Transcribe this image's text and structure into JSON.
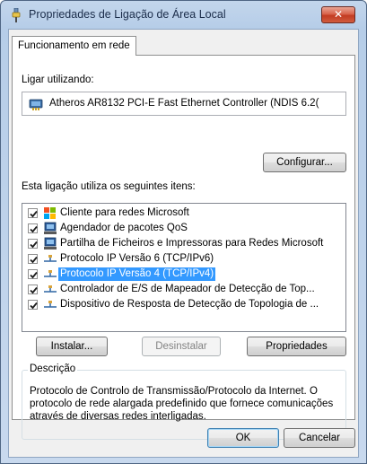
{
  "window": {
    "title": "Propriedades de Ligação de Área Local",
    "close_glyph": "✕"
  },
  "tabs": [
    {
      "label": "Funcionamento em rede",
      "active": true
    }
  ],
  "connect_using": {
    "label": "Ligar utilizando:",
    "adapter_name": "Atheros AR8132 PCI-E Fast Ethernet Controller (NDIS 6.2(",
    "adapter_icon": "network-adapter-icon",
    "configure_button": "Configurar..."
  },
  "items_section": {
    "label": "Esta ligação utiliza os seguintes itens:",
    "items": [
      {
        "label": "Cliente para redes Microsoft",
        "checked": true,
        "icon": "network-client-icon",
        "selected": false
      },
      {
        "label": "Agendador de pacotes QoS",
        "checked": true,
        "icon": "network-service-icon",
        "selected": false
      },
      {
        "label": "Partilha de Ficheiros e Impressoras para Redes Microsoft",
        "checked": true,
        "icon": "network-service-icon",
        "selected": false
      },
      {
        "label": "Protocolo IP Versão 6 (TCP/IPv6)",
        "checked": true,
        "icon": "network-protocol-icon",
        "selected": false
      },
      {
        "label": "Protocolo IP Versão 4 (TCP/IPv4)",
        "checked": true,
        "icon": "network-protocol-icon",
        "selected": true
      },
      {
        "label": "Controlador de E/S de Mapeador de Detecção de Top...",
        "checked": true,
        "icon": "network-protocol-icon",
        "selected": false
      },
      {
        "label": "Dispositivo de Resposta de Detecção de Topologia de ...",
        "checked": true,
        "icon": "network-protocol-icon",
        "selected": false
      }
    ]
  },
  "actions": {
    "install": "Instalar...",
    "uninstall": "Desinstalar",
    "properties": "Propriedades"
  },
  "description": {
    "legend": "Descrição",
    "text": "Protocolo de Controlo de Transmissão/Protocolo da Internet. O protocolo de rede alargada predefinido que fornece comunicações através de diversas redes interligadas."
  },
  "footer": {
    "ok": "OK",
    "cancel": "Cancelar"
  },
  "colors": {
    "selection": "#3399ff",
    "close_button": "#c23b22",
    "title_gradient": "#b6cde8"
  }
}
